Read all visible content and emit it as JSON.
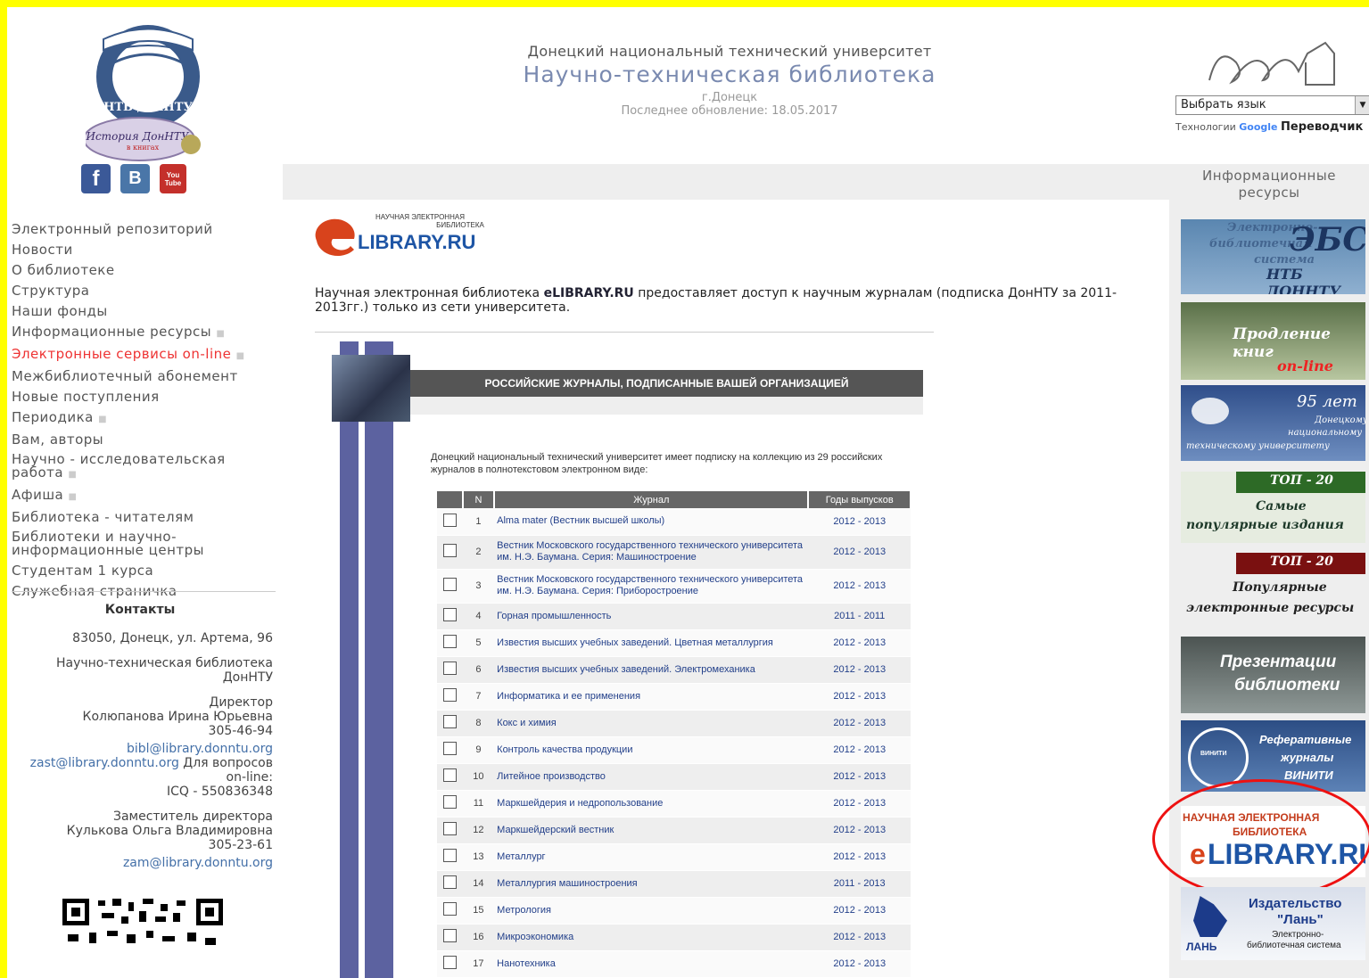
{
  "header": {
    "university": "Донецкий национальный технический университет",
    "library": "Научно-техническая библиотека",
    "city": "г.Донецк",
    "updated": "Последнее обновление: 18.05.2017",
    "logo_text": "НТБ ДонНТУ",
    "history_text": "История ДонНТУ",
    "history_sub": "в книгах",
    "language_select": "Выбрать язык",
    "translator_prefix": "Технологии",
    "translator_brand": "Google",
    "translator_suffix": "Переводчик"
  },
  "social": [
    "f",
    "B",
    "You Tube"
  ],
  "menu": [
    {
      "label": "Электронный репозиторий",
      "dot": ""
    },
    {
      "label": "Новости",
      "dot": ""
    },
    {
      "label": "О библиотеке",
      "dot": ""
    },
    {
      "label": "Структура",
      "dot": ""
    },
    {
      "label": "Наши фонды",
      "dot": ""
    },
    {
      "label": "Информационные ресурсы",
      "dot": "■"
    },
    {
      "label": "Электронные сервисы on-line",
      "dot": "■"
    },
    {
      "label": "Межбиблиотечный абонемент",
      "dot": ""
    },
    {
      "label": "Новые поступления",
      "dot": ""
    },
    {
      "label": "Периодика",
      "dot": "■"
    },
    {
      "label": "Вам, авторы",
      "dot": ""
    },
    {
      "label": "Научно - исследовательская работа",
      "dot": "■"
    },
    {
      "label": "Афиша",
      "dot": "■"
    },
    {
      "label": "Библиотека - читателям",
      "dot": ""
    },
    {
      "label": "Библиотеки и научно-информационные центры",
      "dot": ""
    },
    {
      "label": "Студентам 1 курса",
      "dot": ""
    },
    {
      "label": "Служебная страничка",
      "dot": ""
    }
  ],
  "contacts": {
    "title": "Контакты",
    "address": "83050, Донецк, ул. Артема, 96",
    "org": "Научно-техническая библиотека ДонНТУ",
    "director_title": "Директор",
    "director_name": "Колюпанова Ирина Юрьевна",
    "director_phone": "305-46-94",
    "email1": "bibl@library.donntu.org",
    "email2": "zast@library.donntu.org",
    "online_note": "Для вопросов on-line:",
    "icq": "ICQ - 550836348",
    "deputy_title": "Заместитель директора",
    "deputy_name": "Кулькова Ольга Владимировна",
    "deputy_phone": "305-23-61",
    "email3": "zam@library.donntu.org"
  },
  "content": {
    "elib_logo_top": "НАУЧНАЯ ЭЛЕКТРОННАЯ",
    "elib_logo_mid": "БИБЛИОТЕКА",
    "elib_logo_main": "LIBRARY.RU",
    "intro_pre": "Научная электронная библиотека ",
    "intro_brand": "eLIBRARY.RU",
    "intro_post": " предоставляет доступ к научным журналам (подписка ДонНТУ за 2011-2013гг.) только из сети университета.",
    "frame_title": "РОССИЙСКИЕ ЖУРНАЛЫ, ПОДПИСАННЫЕ ВАШЕЙ ОРГАНИЗАЦИЕЙ",
    "frame_intro": "Донецкий национальный технический университет имеет подписку на коллекцию из 29 российских журналов в полнотекстовом электронном виде:",
    "table_headers": [
      "",
      "N",
      "Журнал",
      "Годы выпусков"
    ],
    "journals": [
      {
        "n": "1",
        "name": "Alma mater (Вестник высшей школы)",
        "years": "2012 - 2013"
      },
      {
        "n": "2",
        "name": "Вестник Московского государственного технического университета им. Н.Э. Баумана. Серия: Машиностроение",
        "years": "2012 - 2013"
      },
      {
        "n": "3",
        "name": "Вестник Московского государственного технического университета им. Н.Э. Баумана. Серия: Приборостроение",
        "years": "2012 - 2013"
      },
      {
        "n": "4",
        "name": "Горная промышленность",
        "years": "2011 - 2011"
      },
      {
        "n": "5",
        "name": "Известия высших учебных заведений. Цветная металлургия",
        "years": "2012 - 2013"
      },
      {
        "n": "6",
        "name": "Известия высших учебных заведений. Электромеханика",
        "years": "2012 - 2013"
      },
      {
        "n": "7",
        "name": "Информатика и ее применения",
        "years": "2012 - 2013"
      },
      {
        "n": "8",
        "name": "Кокс и химия",
        "years": "2012 - 2013"
      },
      {
        "n": "9",
        "name": "Контроль качества продукции",
        "years": "2012 - 2013"
      },
      {
        "n": "10",
        "name": "Литейное производство",
        "years": "2012 - 2013"
      },
      {
        "n": "11",
        "name": "Маркшейдерия и недропользование",
        "years": "2012 - 2013"
      },
      {
        "n": "12",
        "name": "Маркшейдерский вестник",
        "years": "2012 - 2013"
      },
      {
        "n": "13",
        "name": "Металлург",
        "years": "2012 - 2013"
      },
      {
        "n": "14",
        "name": "Металлургия машиностроения",
        "years": "2011 - 2013"
      },
      {
        "n": "15",
        "name": "Метрология",
        "years": "2012 - 2013"
      },
      {
        "n": "16",
        "name": "Микроэкономика",
        "years": "2012 - 2013"
      },
      {
        "n": "17",
        "name": "Нанотехника",
        "years": "2012 - 2013"
      }
    ]
  },
  "right": {
    "heading": "Информационные ресурсы",
    "ebs": [
      "Электронно-",
      "библиотечная",
      "система",
      "ЭБС",
      "НТБ ДОННТУ"
    ],
    "prolong": [
      "Продление книг",
      "on-line"
    ],
    "anniv": [
      "95 лет",
      "Донецкому",
      "национальному",
      "техническому университету"
    ],
    "top20a": [
      "ТОП - 20",
      "Самые",
      "популярные издания"
    ],
    "top20b": [
      "ТОП - 20",
      "Популярные",
      "электронные ресурсы"
    ],
    "present": [
      "Презентации",
      "библиотеки"
    ],
    "viniti": [
      "Реферативные",
      "журналы",
      "ВИНИТИ",
      "ВИНИТИ"
    ],
    "elib": [
      "НАУЧНАЯ ЭЛЕКТРОННАЯ",
      "БИБЛИОТЕКА",
      "LIBRARY.RU"
    ],
    "lan": [
      "Издательство",
      "\"Лань\"",
      "Электронно-",
      "библиотечная система",
      "ЛАНЬ"
    ]
  },
  "colors": {
    "accent": "#5c62a0",
    "active_menu": "#e33333",
    "highlight": "#e11111",
    "page_border": "#ffff00"
  }
}
